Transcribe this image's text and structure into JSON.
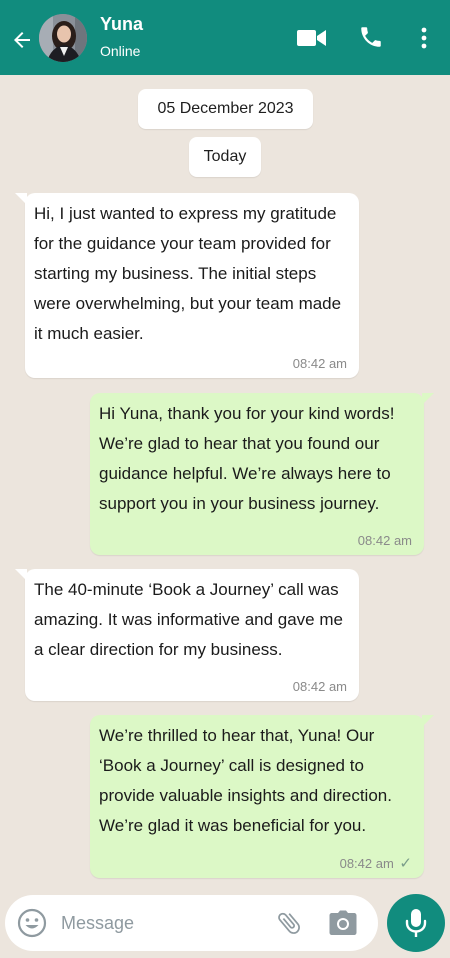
{
  "header": {
    "contact_name": "Yuna",
    "contact_status": "Online",
    "bg_color": "#118c7e"
  },
  "chat": {
    "date_chip": "05 December 2023",
    "today_chip": "Today",
    "messages": [
      {
        "direction": "incoming",
        "text": "Hi, I just wanted to express my gratitude for the guidance your team provided for starting my business. The initial steps were overwhelming, but your team made it much easier.",
        "time": "08:42 am"
      },
      {
        "direction": "outgoing",
        "text": "Hi Yuna, thank you for your kind words! We’re glad to hear that you found our guidance helpful. We’re always here to support you in your business journey.",
        "time": "08:42 am"
      },
      {
        "direction": "incoming",
        "text": "The 40-minute ‘Book a Journey’ call was amazing. It was informative and gave me a clear direction for my business.",
        "time": "08:42 am"
      },
      {
        "direction": "outgoing",
        "text": "We’re thrilled to hear that, Yuna! Our ‘Book a Journey’ call is designed to provide valuable insights and direction. We’re glad it was beneficial for you.",
        "time": "08:42 am",
        "status": "sent-check"
      }
    ]
  },
  "composer": {
    "placeholder": "Message",
    "value": ""
  },
  "icons": {
    "back": "arrow-left-icon",
    "video": "video-camera-icon",
    "call": "phone-icon",
    "menu": "more-vertical-icon",
    "emoji": "emoji-icon",
    "attach": "paperclip-icon",
    "camera": "camera-icon",
    "mic": "microphone-icon"
  },
  "colors": {
    "accent": "#118c7e",
    "incoming_bubble": "#ffffff",
    "outgoing_bubble": "#dcf8c6",
    "chat_bg": "#ece5dd"
  }
}
